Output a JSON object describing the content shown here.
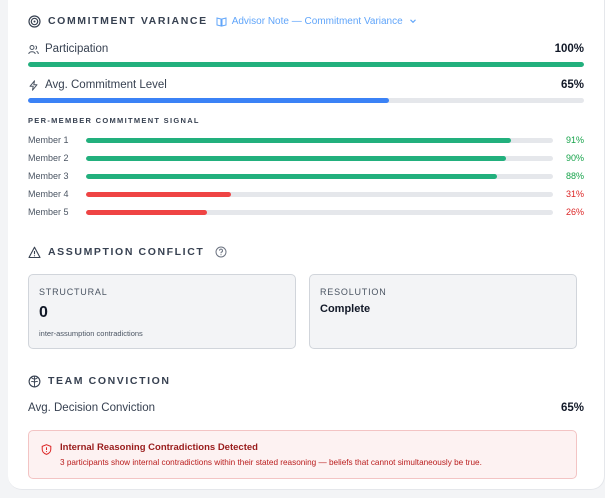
{
  "commitment": {
    "title": "COMMITMENT VARIANCE",
    "advisor_note": "Advisor Note — Commitment Variance",
    "participation": {
      "label": "Participation",
      "value": "100%",
      "percent": 100
    },
    "avg_commitment": {
      "label": "Avg. Commitment Level",
      "value": "65%",
      "percent": 65
    },
    "per_member_title": "PER-MEMBER COMMITMENT SIGNAL",
    "members": [
      {
        "name": "Member 1",
        "value": "91%",
        "percent": 91,
        "status": "high"
      },
      {
        "name": "Member 2",
        "value": "90%",
        "percent": 90,
        "status": "high"
      },
      {
        "name": "Member 3",
        "value": "88%",
        "percent": 88,
        "status": "high"
      },
      {
        "name": "Member 4",
        "value": "31%",
        "percent": 31,
        "status": "low"
      },
      {
        "name": "Member 5",
        "value": "26%",
        "percent": 26,
        "status": "low"
      }
    ]
  },
  "assumption": {
    "title": "ASSUMPTION CONFLICT",
    "structural": {
      "label": "STRUCTURAL",
      "value": "0",
      "sub": "inter-assumption contradictions"
    },
    "resolution": {
      "label": "RESOLUTION",
      "value": "Complete"
    }
  },
  "conviction": {
    "title": "TEAM CONVICTION",
    "label": "Avg. Decision Conviction",
    "value": "65%"
  },
  "alert": {
    "title": "Internal Reasoning Contradictions Detected",
    "body": "3 participants show internal contradictions within their stated reasoning — beliefs that cannot simultaneously be true."
  },
  "colors": {
    "green": "#22b07d",
    "blue": "#3b82f6",
    "red": "#ef4444",
    "green_text": "#16a34a",
    "red_text": "#dc2626"
  },
  "icons": {
    "commitment": "target-icon",
    "advisor_note": "book-icon",
    "participation": "users-icon",
    "avg_commitment": "bolt-icon",
    "assumption": "warning-icon",
    "help": "help-circle-icon",
    "conviction": "brain-icon",
    "alert": "shield-alert-icon"
  }
}
